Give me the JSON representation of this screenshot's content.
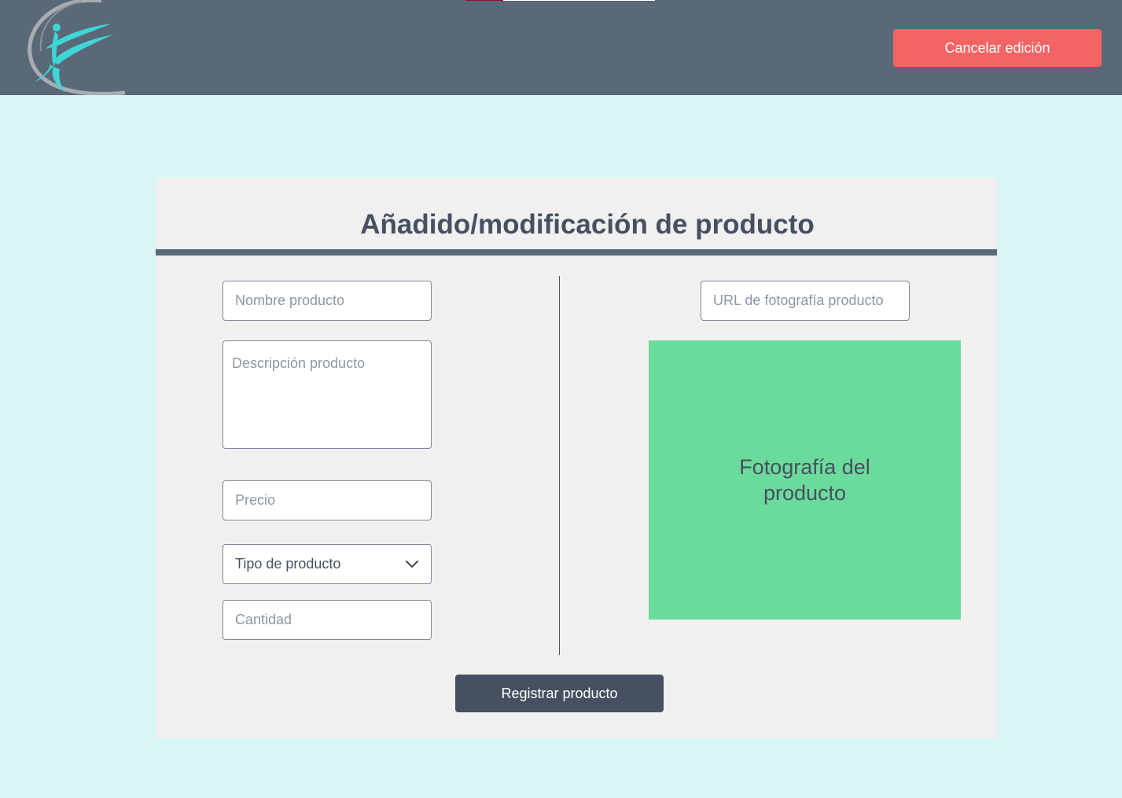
{
  "header": {
    "logo_icon": "gymnast-swoosh-logo",
    "cancel_label": "Cancelar edición"
  },
  "form": {
    "title": "Añadido/modificación de producto",
    "name_placeholder": "Nombre producto",
    "description_placeholder": "Descripción producto",
    "price_placeholder": "Precio",
    "type_select": {
      "selected": "Tipo de producto",
      "icon": "chevron-down-icon"
    },
    "quantity_placeholder": "Cantidad",
    "photo_url_placeholder": "URL de fotografía producto",
    "photo_preview_label": "Fotografía del producto",
    "submit_label": "Registrar producto"
  },
  "colors": {
    "header_bg": "#5a6978",
    "page_bg": "#d8f6f4",
    "card_bg": "#f0f0f0",
    "cancel_button": "#f56464",
    "submit_button": "#475060",
    "photo_placeholder": "#6bdb9b",
    "logo_accent": "#3ed6d8"
  }
}
